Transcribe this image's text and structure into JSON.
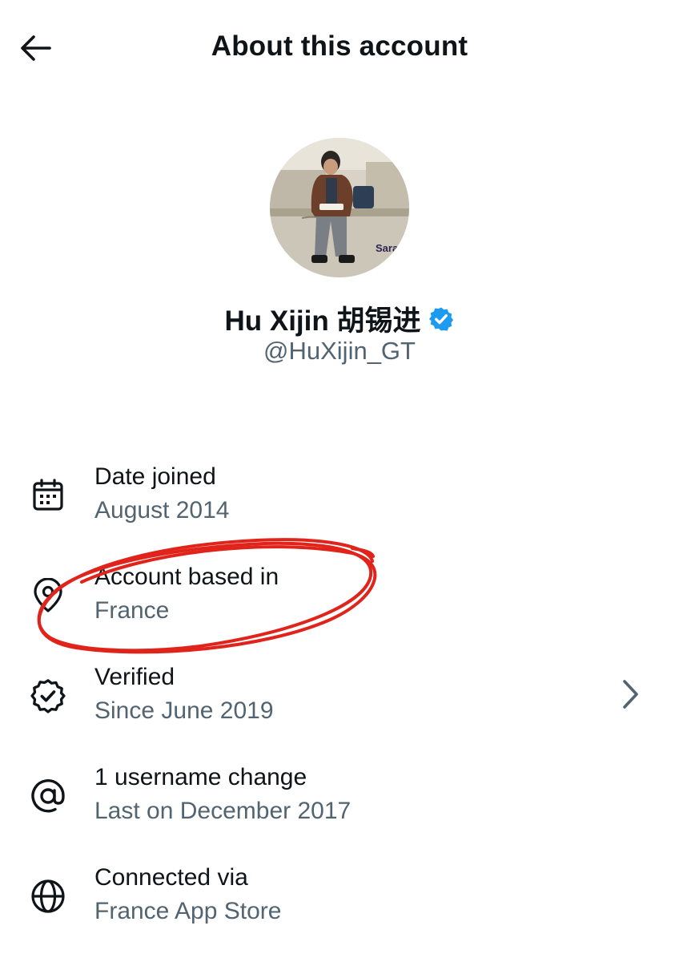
{
  "header": {
    "back_icon": "arrow-left-icon",
    "title": "About this account"
  },
  "profile": {
    "avatar_caption": "Saraje",
    "display_name": "Hu Xijin 胡锡进",
    "verified_badge_icon": "verified-badge-icon",
    "badge_color": "#1d9bf0",
    "handle": "@HuXijin_GT"
  },
  "details": [
    {
      "icon": "calendar-icon",
      "title": "Date joined",
      "subtitle": "August 2014"
    },
    {
      "icon": "location-pin-icon",
      "title": "Account based in",
      "subtitle": "France"
    },
    {
      "icon": "verified-check-icon",
      "title": "Verified",
      "subtitle": "Since June 2019",
      "chevron_icon": "chevron-right-icon"
    },
    {
      "icon": "at-sign-icon",
      "title": "1 username change",
      "subtitle": "Last on December 2017"
    },
    {
      "icon": "globe-icon",
      "title": "Connected via",
      "subtitle": "France App Store"
    }
  ],
  "annotation": {
    "type": "hand-drawn circle",
    "color": "#e0241b",
    "target": "Account based in"
  },
  "colors": {
    "text_primary": "#0f1419",
    "text_secondary": "#536471",
    "background": "#ffffff"
  }
}
